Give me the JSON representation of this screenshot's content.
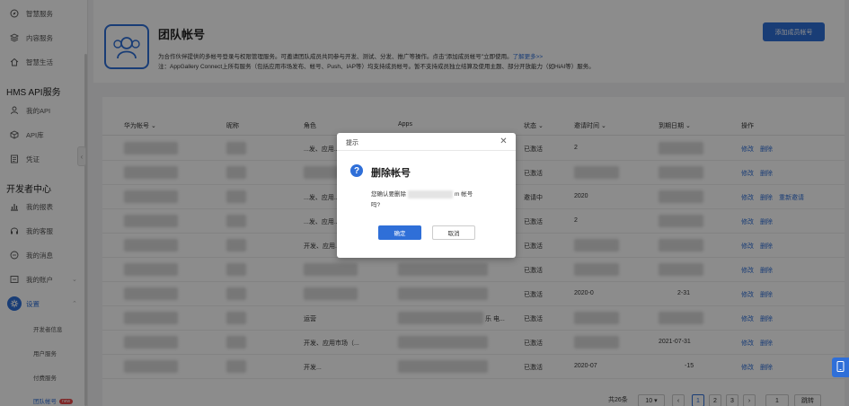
{
  "sidebar": {
    "items_top": [
      {
        "label": "智慧服务",
        "icon": "compass-icon"
      },
      {
        "label": "内容服务",
        "icon": "layers-icon"
      },
      {
        "label": "智慧生活",
        "icon": "home-icon"
      }
    ],
    "section_hms": "HMS API服务",
    "items_hms": [
      {
        "label": "我的API",
        "icon": "user-api-icon"
      },
      {
        "label": "API库",
        "icon": "cube-icon"
      },
      {
        "label": "凭证",
        "icon": "document-icon"
      }
    ],
    "section_dev": "开发者中心",
    "items_dev": [
      {
        "label": "我的报表",
        "icon": "bar-chart-icon"
      },
      {
        "label": "我的客服",
        "icon": "headset-icon"
      },
      {
        "label": "我的消息",
        "icon": "message-icon"
      },
      {
        "label": "我的账户",
        "icon": "account-icon"
      },
      {
        "label": "设置",
        "icon": "gear-icon"
      }
    ],
    "sub_items": [
      "开发者信息",
      "用户服务",
      "付费服务",
      "团队帐号"
    ],
    "new_badge": "new"
  },
  "header": {
    "title": "团队帐号",
    "desc1": "为合作伙伴提供的多帐号登录与权限管理服务。可邀请团队成员共同参与开发、测试、分发、推广等操作。点击\"添加成员帐号\"立即使用。",
    "desc1_link": "了解更多>>",
    "desc2": "注：AppGallery Connect上所有服务（包括应用市场发布、帐号、Push、IAP等）均支持成员帐号。暂不支持成员独立结算及使用主题、部分开放能力（如HiAI等）服务。",
    "add_button": "添加成员帐号"
  },
  "table": {
    "headers": [
      "华为帐号 ⌄",
      "昵称",
      "角色",
      "Apps",
      "状态 ⌄",
      "邀请时间 ⌄",
      "到期日期 ⌄",
      "操作"
    ],
    "rows": [
      {
        "status": "已激活",
        "invite": "2",
        "role": "...发、应用...",
        "extra": false
      },
      {
        "status": "已激活",
        "invite": "",
        "role": "",
        "extra": false
      },
      {
        "status": "邀请中",
        "invite": "2020",
        "role": "...发、应用...",
        "extra": true
      },
      {
        "status": "已激活",
        "invite": "2",
        "role": "...发、应用...",
        "extra": false
      },
      {
        "status": "已激活",
        "invite": "",
        "role": "开发、应用...",
        "extra": false
      },
      {
        "status": "已激活",
        "invite": "",
        "role": "",
        "extra": false
      },
      {
        "status": "已激活",
        "invite": "2020-0",
        "role": "",
        "expire": "2-31",
        "extra": false
      },
      {
        "status": "已激活",
        "invite": "",
        "role": "运营",
        "apps_tail": "乐 电...",
        "extra": false
      },
      {
        "status": "已激活",
        "invite": "",
        "role": "开发、应用市场（...",
        "expire": "2021-07-31",
        "extra": false
      },
      {
        "status": "已激活",
        "invite": "2020-07",
        "role": "开发...",
        "expire": "-15",
        "extra": false
      }
    ],
    "action_edit": "修改",
    "action_delete": "删除",
    "action_reinvite": "重新邀请"
  },
  "pager": {
    "total": "共26条",
    "page_size": "10",
    "pages": [
      "1",
      "2",
      "3"
    ],
    "jump_value": "1",
    "jump_label": "跳转"
  },
  "dialog": {
    "title": "提示",
    "heading": "删除帐号",
    "msg_prefix": "您确认要删除",
    "msg_suffix": "m 帐号",
    "msg_line2": "吗?",
    "ok": "确定",
    "cancel": "取消"
  }
}
